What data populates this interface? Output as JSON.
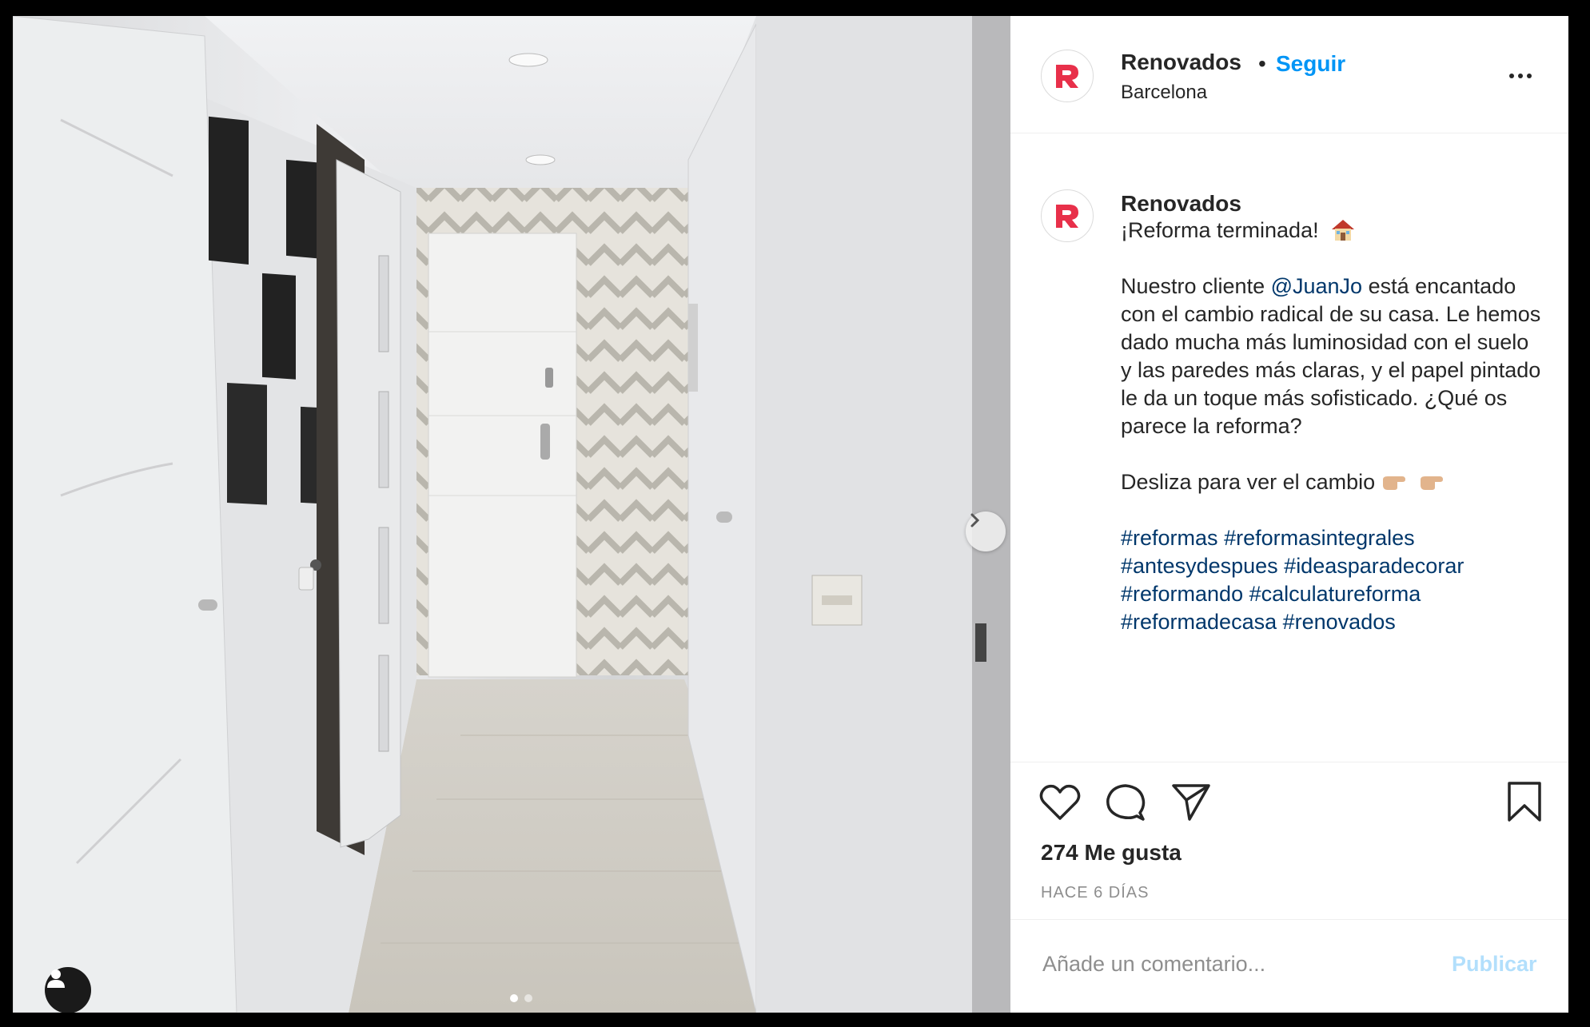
{
  "post": {
    "account": "Renovados",
    "follow_label": "Seguir",
    "separator": "•",
    "location": "Barcelona",
    "more_icon": "more-options-icon"
  },
  "caption": {
    "account": "Renovados",
    "line1": "¡Reforma terminada!",
    "intro": "Nuestro cliente ",
    "mention": "@JuanJo",
    "body_1": " está encantado con el cambio radical de su casa. Le hemos dado mucha más luminosidad con el suelo y las paredes más claras, y el papel pintado le da un toque más sofisticado.",
    "question": "¿Qué os parece la reforma?",
    "swipe": "Desliza para ver el cambio",
    "hashtags": [
      "#reformas",
      "#reformasintegrales",
      "#antesydespues",
      "#ideasparadecorar",
      "#reformando",
      "#calculatureforma",
      "#reformadecasa",
      "#renovados"
    ]
  },
  "actions": {
    "likes": "274 Me gusta",
    "time": "HACE 6 DÍAS",
    "icons": [
      "heart-icon",
      "comment-icon",
      "share-icon",
      "bookmark-icon"
    ]
  },
  "comment": {
    "placeholder": "Añade un comentario...",
    "publish_label": "Publicar"
  },
  "carousel": {
    "slide_count": 2,
    "active_slide": 1
  },
  "colors": {
    "brand": "#e8304a",
    "link": "#0095f6",
    "hashtag": "#00376b",
    "publish_disabled": "#b2dffc"
  }
}
